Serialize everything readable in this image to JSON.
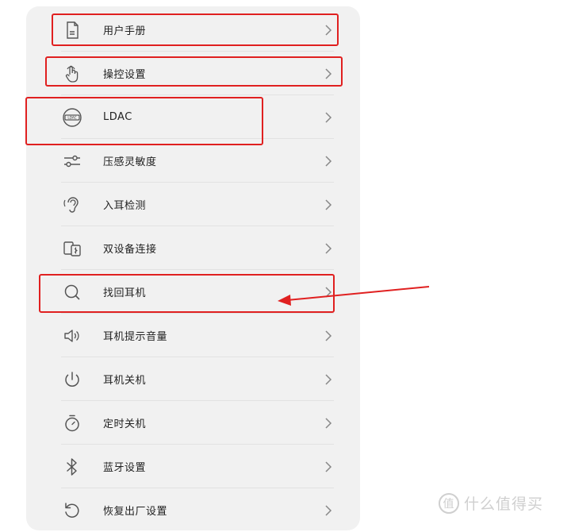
{
  "menu": {
    "items": [
      {
        "label": "用户手册",
        "icon": "document-icon"
      },
      {
        "label": "操控设置",
        "icon": "touch-gesture-icon"
      },
      {
        "label": "LDAC",
        "icon": "ldac-badge-icon",
        "badge_text": "LDAC"
      },
      {
        "label": "压感灵敏度",
        "icon": "sliders-icon"
      },
      {
        "label": "入耳检测",
        "icon": "ear-icon"
      },
      {
        "label": "双设备连接",
        "icon": "dual-device-icon"
      },
      {
        "label": "找回耳机",
        "icon": "search-icon"
      },
      {
        "label": "耳机提示音量",
        "icon": "speaker-volume-icon"
      },
      {
        "label": "耳机关机",
        "icon": "power-icon"
      },
      {
        "label": "定时关机",
        "icon": "timer-icon"
      },
      {
        "label": "蓝牙设置",
        "icon": "bluetooth-icon"
      },
      {
        "label": "恢复出厂设置",
        "icon": "reset-icon"
      }
    ]
  },
  "watermark": {
    "text": "什么值得买",
    "logo_glyph": "值"
  },
  "colors": {
    "highlight": "#e02020",
    "text": "#222222",
    "icon": "#555555",
    "background": "#f1f1f1"
  }
}
